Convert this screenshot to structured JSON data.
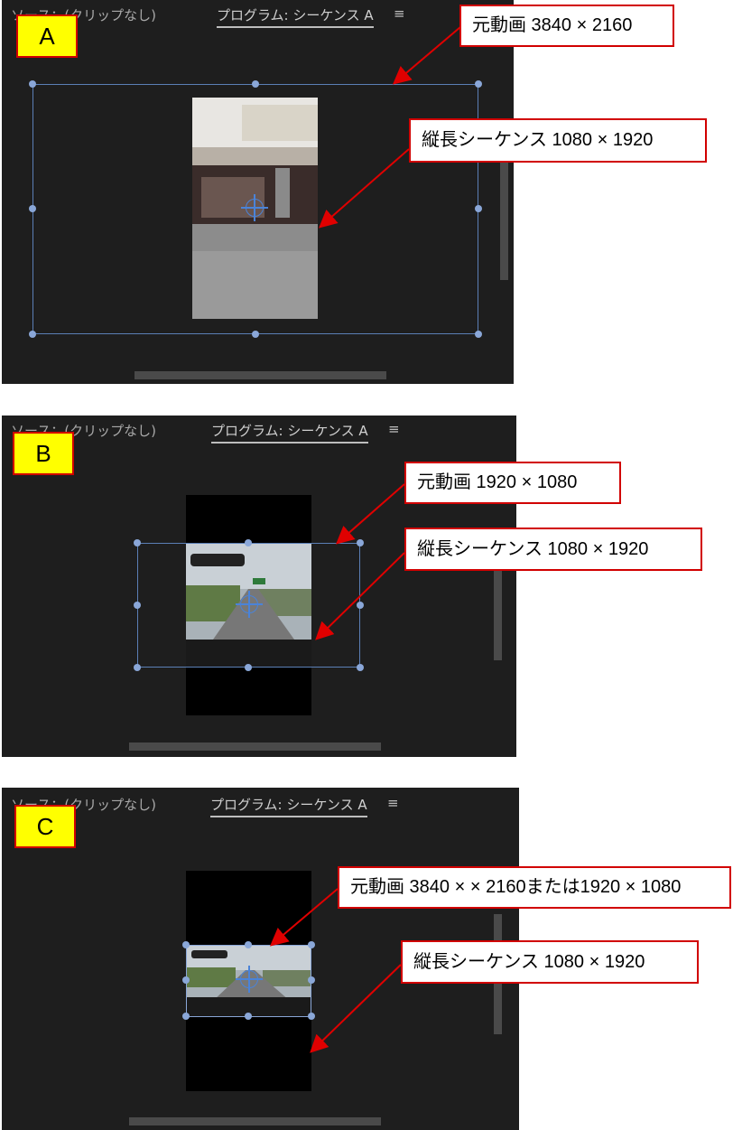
{
  "panels": [
    {
      "label": "A",
      "source_tab": "ソース：(クリップなし)",
      "program_tab": "プログラム: シーケンス A",
      "menu_icon": "≡",
      "callouts": [
        "元動画 3840 × 2160",
        "縦長シーケンス 1080 × 1920"
      ]
    },
    {
      "label": "B",
      "source_tab": "ソース：(クリップなし)",
      "program_tab": "プログラム: シーケンス A",
      "menu_icon": "≡",
      "callouts": [
        "元動画 1920 × 1080",
        "縦長シーケンス 1080 × 1920"
      ]
    },
    {
      "label": "C",
      "source_tab": "ソース：(クリップなし)",
      "program_tab": "プログラム: シーケンス A",
      "menu_icon": "≡",
      "callouts": [
        "元動画 3840 × × 2160または1920 × 1080",
        "縦長シーケンス 1080 × 1920"
      ]
    }
  ],
  "colors": {
    "panel_bg": "#1e1e1e",
    "bbox": "#5b7fb6",
    "callout_border": "#d10000",
    "badge_bg": "#ffff00"
  }
}
